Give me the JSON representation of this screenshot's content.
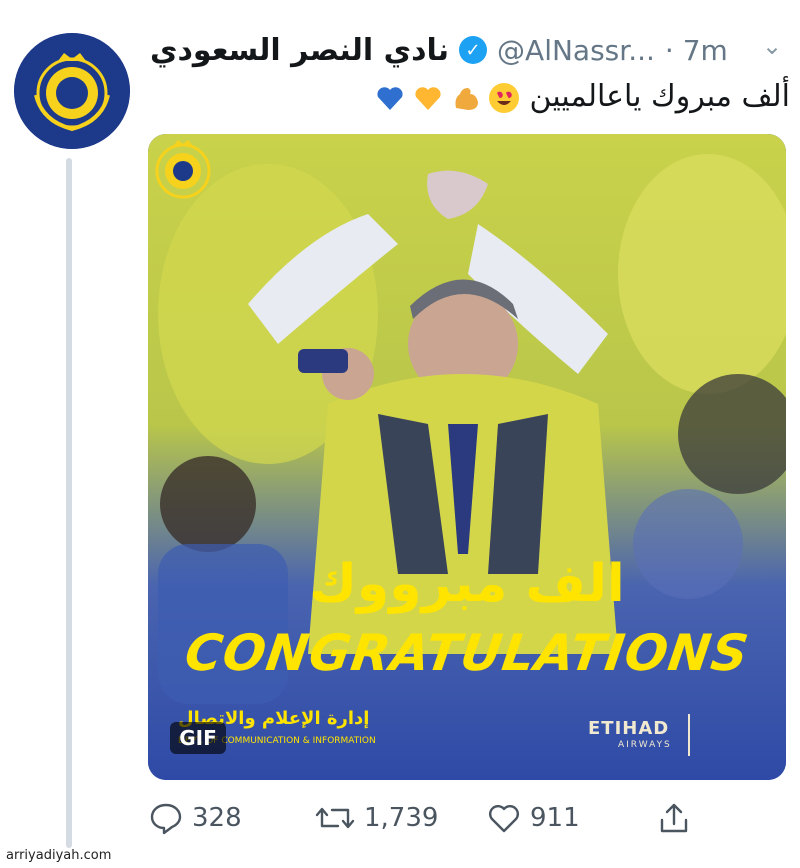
{
  "tweet": {
    "display_name": "نادي النصر السعودي",
    "handle": "@AlNassr...",
    "time": "· 7m",
    "text": "ألف مبروك ياعالميين",
    "emojis": [
      "heart-eyes",
      "flexed-biceps",
      "yellow-heart",
      "blue-heart"
    ]
  },
  "media": {
    "overlay_arabic": "الف مبرووك",
    "overlay_english": "CONGRATULATIONS",
    "footer_arabic": "إدارة الإعلام والاتصال",
    "footer_english": "DEPT. OF COMMUNICATION & INFORMATION",
    "sponsor": "ETIHAD",
    "sponsor_sub": "AIRWAYS",
    "badge": "GIF"
  },
  "actions": {
    "replies": "328",
    "retweets": "1,739",
    "likes": "911"
  },
  "watermark": "arriyadiyah.com",
  "colors": {
    "accent_yellow": "#ffe400",
    "club_blue": "#1d3a8a",
    "verified_blue": "#1da1f2"
  }
}
